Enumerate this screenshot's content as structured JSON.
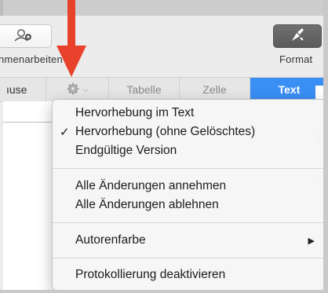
{
  "toolbar": {
    "left_button_label": "nmenarbeiten",
    "format_label": "Format",
    "collab_icon": "collaborate-icon",
    "format_icon": "paintbrush-icon"
  },
  "tabs": {
    "partial_label": "ıuse",
    "gear_icon": "gear-icon",
    "dropdown_icon": "chevron-down-icon",
    "items": [
      {
        "label": "Tabelle"
      },
      {
        "label": "Zelle"
      },
      {
        "label": "Text"
      }
    ],
    "active": "Text"
  },
  "menu": {
    "groups": [
      [
        {
          "label": "Hervorhebung im Text",
          "checked": false
        },
        {
          "label": "Hervorhebung (ohne Gelöschtes)",
          "checked": true
        },
        {
          "label": "Endgültige Version",
          "checked": false
        }
      ],
      [
        {
          "label": "Alle Änderungen annehmen"
        },
        {
          "label": "Alle Änderungen ablehnen"
        }
      ],
      [
        {
          "label": "Autorenfarbe",
          "has_submenu": true
        }
      ],
      [
        {
          "label": "Protokollierung deaktivieren"
        }
      ]
    ],
    "check_glyph": "✓",
    "submenu_glyph": "▶"
  },
  "colors": {
    "accent": "#3a8ff5",
    "annotation_arrow": "#e8412c"
  }
}
